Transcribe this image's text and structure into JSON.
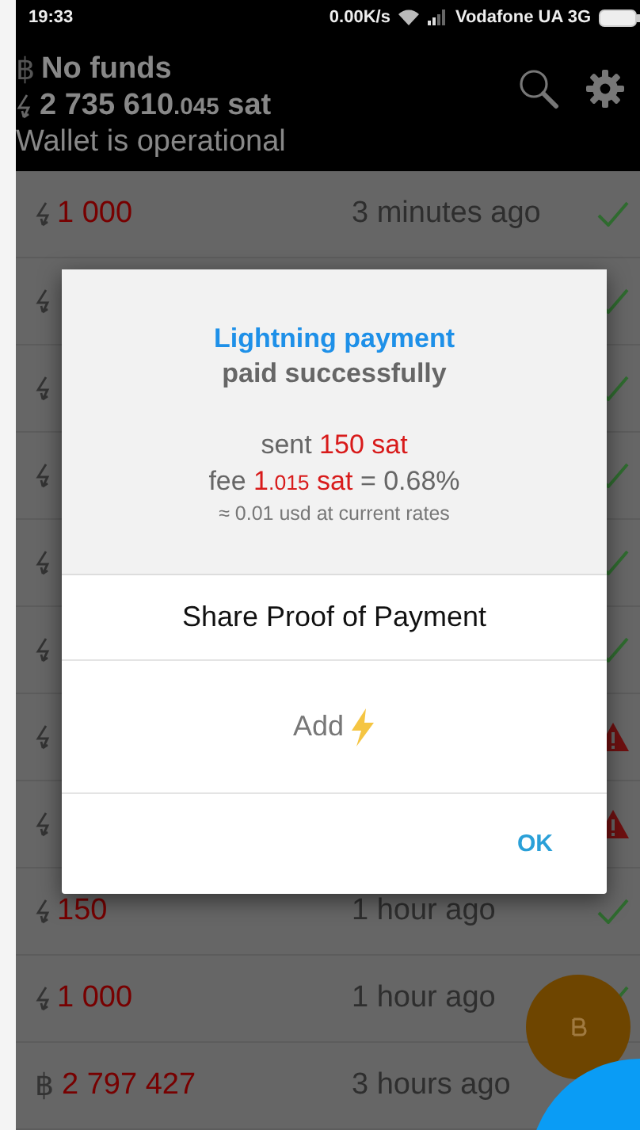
{
  "status_bar": {
    "time": "19:33",
    "speed": "0.00K/s",
    "carrier": "Vodafone UA 3G"
  },
  "header": {
    "balance_symbol": "฿",
    "balance": "No funds",
    "lightning": {
      "whole": "2 735 610",
      "fraction": ".045",
      "unit": "sat"
    },
    "status": "Wallet is operational"
  },
  "transactions": [
    {
      "kind": "lightning",
      "amount": "1 000",
      "time": "3 minutes ago",
      "confirmed": true,
      "failed": false
    },
    {
      "kind": "lightning",
      "confirmed": true,
      "failed": false
    },
    {
      "kind": "lightning",
      "confirmed": true,
      "failed": false
    },
    {
      "kind": "lightning",
      "confirmed": true,
      "failed": false
    },
    {
      "kind": "lightning",
      "confirmed": true,
      "failed": false
    },
    {
      "kind": "lightning",
      "confirmed": true,
      "failed": false
    },
    {
      "kind": "lightning",
      "confirmed": false,
      "failed": true
    },
    {
      "kind": "lightning",
      "confirmed": false,
      "failed": true
    },
    {
      "kind": "lightning",
      "amount": "150",
      "time": "1 hour ago",
      "confirmed": true,
      "failed": false
    },
    {
      "kind": "lightning",
      "amount": "1 000",
      "time": "1 hour ago",
      "confirmed": true,
      "failed": false
    },
    {
      "kind": "bitcoin",
      "symbol": "฿",
      "amount": "2 797 427",
      "time": "3 hours ago",
      "confirmed": false,
      "failed": false
    }
  ],
  "dialog": {
    "title": "Lightning payment",
    "subtitle": "paid successfully",
    "sent": {
      "label": "sent",
      "amount": "150 sat"
    },
    "fee": {
      "label": "fee",
      "whole": "1",
      "fraction": ".015",
      "unit": "sat",
      "rest": "= 0.68%"
    },
    "rate": "≈ 0.01 usd at current rates",
    "share_button": "Share Proof of Payment",
    "add_button": "Add",
    "ok_button": "OK"
  }
}
